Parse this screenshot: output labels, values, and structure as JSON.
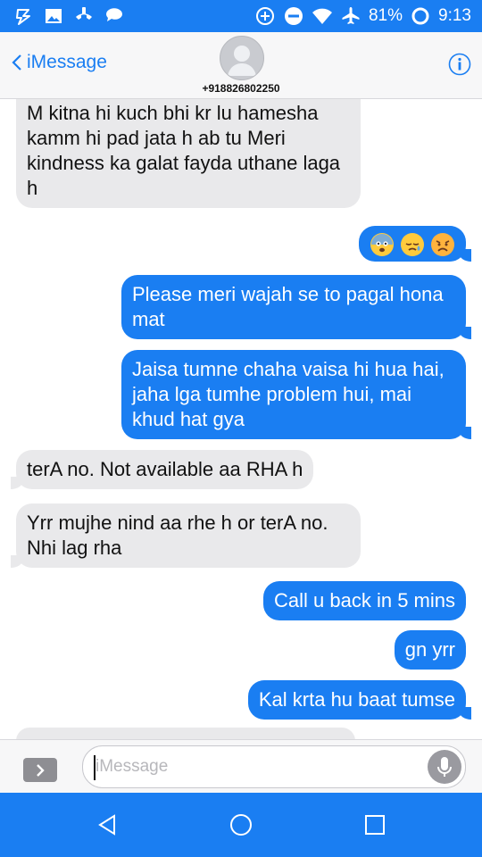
{
  "status_bar": {
    "battery": "81%",
    "time": "9:13"
  },
  "header": {
    "back_label": "iMessage",
    "contact": "+918826802250"
  },
  "messages": [
    {
      "dir": "in",
      "text": "M kitna hi kuch bhi kr lu hamesha kamm hi pad jata h ab tu Meri kindness ka galat fayda uthane laga h"
    },
    {
      "dir": "out",
      "text": "😨😪😥"
    },
    {
      "dir": "out",
      "text": "Please meri wajah se to pagal hona mat"
    },
    {
      "dir": "out",
      "text": "Jaisa tumne chaha vaisa hi hua hai, jaha lga tumhe problem hui, mai khud hat gya"
    },
    {
      "dir": "in",
      "text": "terA no. Not available aa RHA h"
    },
    {
      "dir": "in",
      "text": "Yrr mujhe nind aa rhe h or terA no. Nhi lag rha"
    },
    {
      "dir": "out",
      "text": "Call u back in 5 mins"
    },
    {
      "dir": "out",
      "text": "gn yrr"
    },
    {
      "dir": "out",
      "text": "Kal krta hu baat tumse"
    }
  ],
  "input": {
    "placeholder": "iMessage"
  },
  "colors": {
    "accent": "#1a7ef2",
    "incoming_bubble": "#e9e9eb",
    "outgoing_bubble": "#1a7ef2"
  },
  "icons": {
    "status_left": [
      "sync-icon",
      "image-icon",
      "missed-call-icon",
      "chat-icon"
    ],
    "status_right": [
      "add-circle-icon",
      "do-not-disturb-icon",
      "wifi-icon",
      "airplane-icon",
      "battery-ring-icon"
    ],
    "header": [
      "chevron-left-icon",
      "avatar-icon",
      "info-icon"
    ],
    "input": [
      "expand-chevron-icon",
      "microphone-icon"
    ],
    "nav": [
      "back-triangle-icon",
      "home-circle-icon",
      "recents-square-icon"
    ]
  }
}
